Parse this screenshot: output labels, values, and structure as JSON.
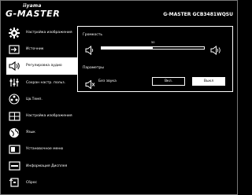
{
  "header": {
    "logo_small": "iiyama",
    "logo_main": "G-MASTER",
    "model": "G-MASTER GCB3481WQSU"
  },
  "menu": [
    {
      "label": "Настройка изображения",
      "icon": "gear-icon"
    },
    {
      "label": "Источник",
      "icon": "input-source-icon"
    },
    {
      "label": "Регулировка аудио",
      "icon": "speaker-icon",
      "active": true
    },
    {
      "label": "Сохран настр. польз.",
      "icon": "save-settings-icon"
    },
    {
      "label": "Цв.Темп.",
      "icon": "color-palette-icon"
    },
    {
      "label": "Настройка изображения",
      "icon": "image-setup-icon"
    },
    {
      "label": "Язык",
      "icon": "globe-icon"
    },
    {
      "label": "Установочное меню",
      "icon": "setup-menu-icon"
    },
    {
      "label": "Информация Дисплея",
      "icon": "display-info-icon"
    },
    {
      "label": "Сброс",
      "icon": "reset-icon"
    }
  ],
  "audio": {
    "volume_label": "Громкость",
    "volume_value": "50",
    "volume_fraction": 0.5,
    "params_label": "Параметры",
    "mute_label": "Без звука",
    "mute_on_label": "Вкл.",
    "mute_off_label": "Выкл",
    "selected": "Выкл"
  }
}
